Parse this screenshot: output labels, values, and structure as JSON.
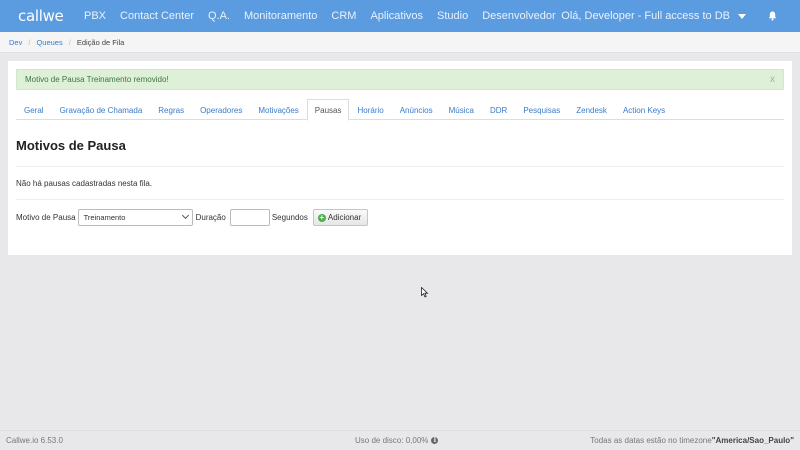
{
  "app": {
    "brand": "callwe"
  },
  "nav": {
    "items": [
      {
        "label": "PBX",
        "name": "nav-item-pbx"
      },
      {
        "label": "Contact Center",
        "name": "nav-item-contact-center"
      },
      {
        "label": "Q.A.",
        "name": "nav-item-qa"
      },
      {
        "label": "Monitoramento",
        "name": "nav-item-monitoramento"
      },
      {
        "label": "CRM",
        "name": "nav-item-crm"
      },
      {
        "label": "Aplicativos",
        "name": "nav-item-aplicativos"
      },
      {
        "label": "Studio",
        "name": "nav-item-studio"
      },
      {
        "label": "Desenvolvedor",
        "name": "nav-item-desenvolvedor"
      }
    ],
    "user_label": "Olá, Developer - Full access to DB"
  },
  "breadcrumb": {
    "items": [
      "Dev",
      "Queues"
    ],
    "active": "Edição de Fila"
  },
  "alert": {
    "message": "Motivo de Pausa Treinamento removido!",
    "close": "x"
  },
  "tabs": {
    "items": [
      "Geral",
      "Gravação de Chamada",
      "Regras",
      "Operadores",
      "Motivações",
      "Pausas",
      "Horário",
      "Anúncios",
      "Música",
      "DDR",
      "Pesquisas",
      "Zendesk",
      "Action Keys"
    ],
    "active_index": 5
  },
  "section": {
    "title": "Motivos de Pausa",
    "empty_message": "Não há pausas cadastradas nesta fila."
  },
  "form": {
    "motivo_label": "Motivo de Pausa",
    "motivo_value": "Treinamento",
    "duracao_label": "Duração",
    "duracao_value": "",
    "segundos_label": "Segundos",
    "add_button": "Adicionar"
  },
  "footer": {
    "version": "Callwe.io 6.53.0",
    "disk_usage": "Uso de disco: 0,00%",
    "timezone_prefix": "Todas as datas estão no timezone",
    "timezone_value": "\"America/Sao_Paulo\""
  },
  "colors": {
    "navbar": "#5b9be0",
    "link": "#3a7bc8",
    "alert_bg": "#dff0d8",
    "alert_text": "#3c763d",
    "add_icon": "#4caf50"
  }
}
